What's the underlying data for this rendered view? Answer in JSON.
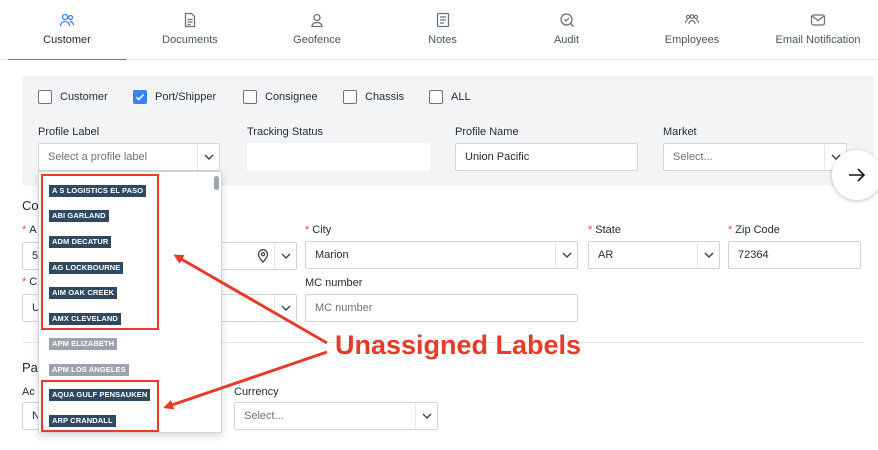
{
  "tabs": [
    {
      "label": "Customer",
      "icon": "users-icon",
      "active": true
    },
    {
      "label": "Documents",
      "icon": "document-icon"
    },
    {
      "label": "Geofence",
      "icon": "location-icon"
    },
    {
      "label": "Notes",
      "icon": "notes-icon"
    },
    {
      "label": "Audit",
      "icon": "audit-icon"
    },
    {
      "label": "Employees",
      "icon": "employees-icon"
    },
    {
      "label": "Email Notification",
      "icon": "email-notification-icon"
    }
  ],
  "filters": {
    "checkboxes": [
      {
        "label": "Customer",
        "checked": false
      },
      {
        "label": "Port/Shipper",
        "checked": true
      },
      {
        "label": "Consignee",
        "checked": false
      },
      {
        "label": "Chassis",
        "checked": false
      },
      {
        "label": "ALL",
        "checked": false
      }
    ],
    "profile_label": {
      "label": "Profile Label",
      "placeholder": "Select a profile label"
    },
    "tracking_status": {
      "label": "Tracking Status",
      "value": ""
    },
    "profile_name": {
      "label": "Profile Name",
      "value": "Union Pacific"
    },
    "market": {
      "label": "Market",
      "placeholder": "Select..."
    }
  },
  "contact": {
    "heading_partial": "Co",
    "address": {
      "label_partial": "A",
      "value_partial": "5"
    },
    "city": {
      "label": "City",
      "value": "Marion"
    },
    "state": {
      "label": "State",
      "value": "AR"
    },
    "zip": {
      "label": "Zip Code",
      "value": "72364"
    },
    "country": {
      "label_partial": "C",
      "value_partial": "U"
    },
    "mc_number": {
      "label": "MC number",
      "placeholder": "MC number"
    }
  },
  "payment": {
    "heading_partial": "Pa",
    "account_label_partial": "Ac",
    "account_value_partial": "N",
    "currency": {
      "label": "Currency",
      "placeholder": "Select..."
    }
  },
  "dropdown": {
    "items": [
      {
        "label": "A S LOGISTICS EL PASO",
        "assigned": false
      },
      {
        "label": "ABI GARLAND",
        "assigned": false
      },
      {
        "label": "ADM DECATUR",
        "assigned": false
      },
      {
        "label": "AG LOCKBOURNE",
        "assigned": false
      },
      {
        "label": "AIM OAK CREEK",
        "assigned": false
      },
      {
        "label": "AMX CLEVELAND",
        "assigned": false
      },
      {
        "label": "APM ELIZABETH",
        "assigned": true
      },
      {
        "label": "APM LOS ANGELES",
        "assigned": true
      },
      {
        "label": "AQUA GULF PENSAUKEN",
        "assigned": false
      },
      {
        "label": "ARP CRANDALL",
        "assigned": false
      }
    ]
  },
  "annotation": {
    "text": "Unassigned Labels",
    "color": "#e63b28"
  },
  "colors": {
    "accent": "#3b82f6",
    "label_bg": "#2f4a60",
    "label_muted_bg": "#9ca3af"
  }
}
